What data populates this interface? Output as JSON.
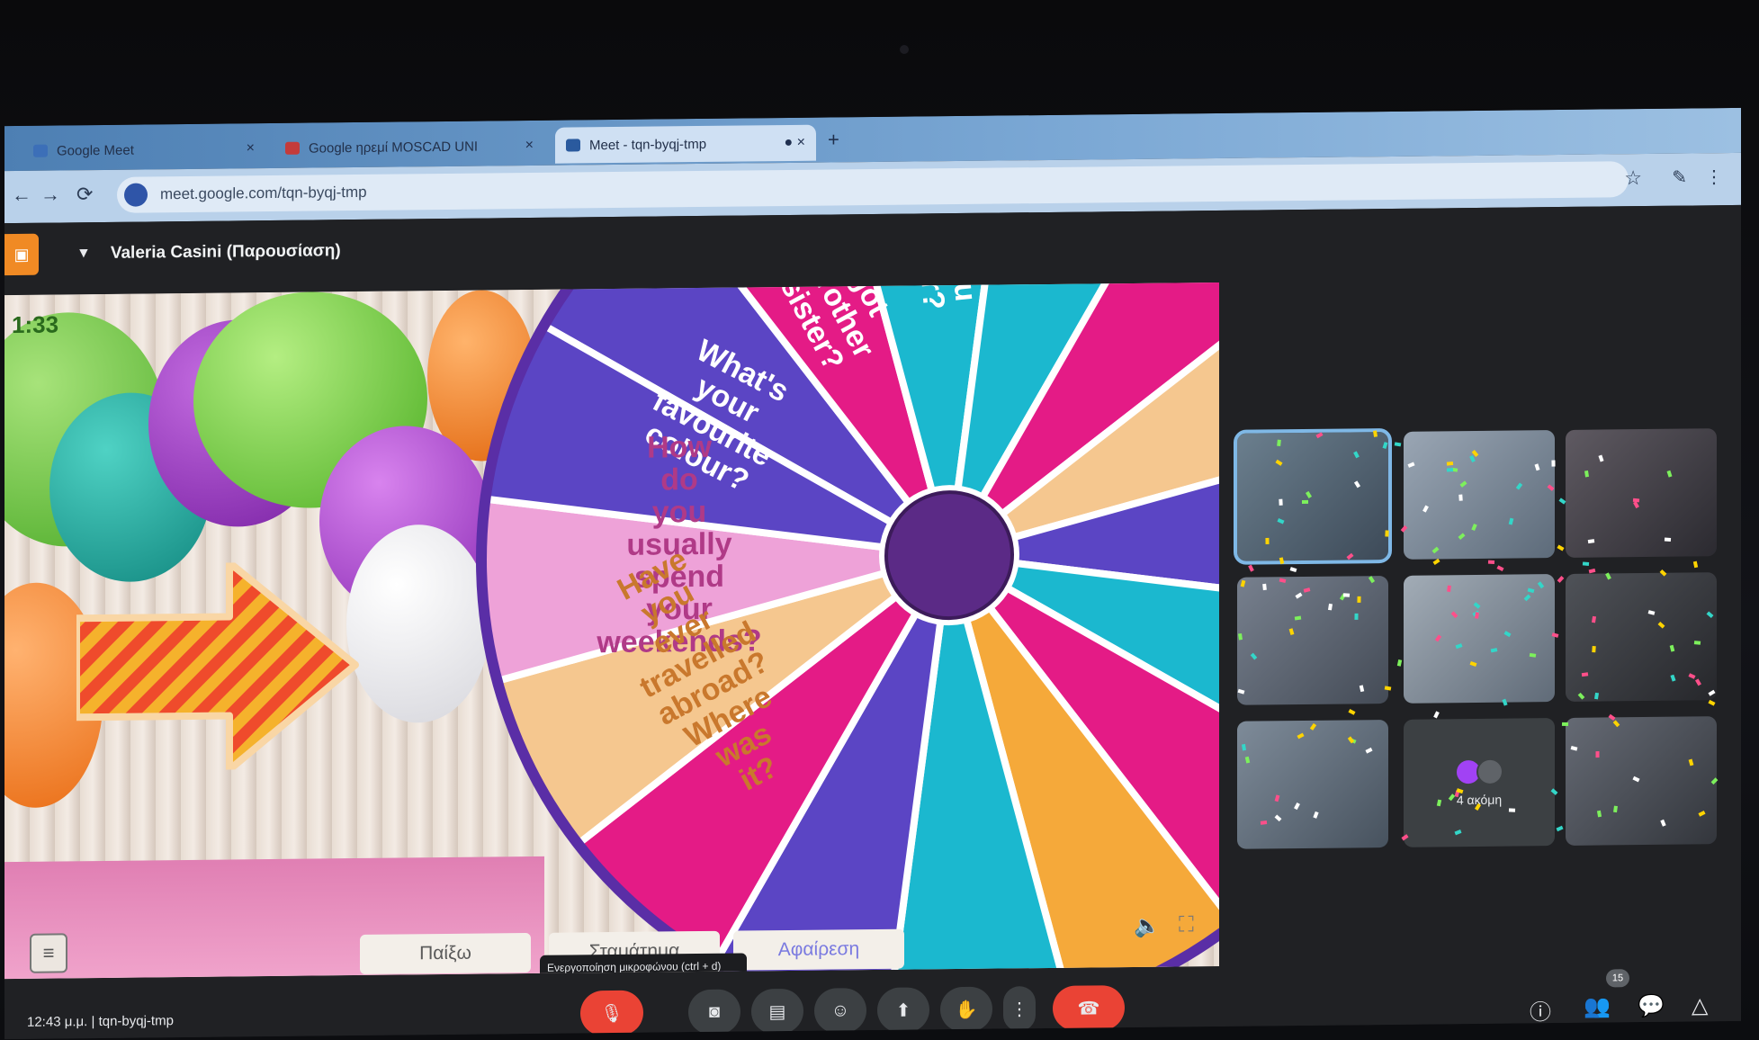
{
  "browser": {
    "tabs": [
      {
        "title": "Google Meet",
        "color": "#3c6fb8"
      },
      {
        "title": "Google ηρεμί MOSCAD UNI",
        "color": "#c43b3b"
      },
      {
        "title": "Meet - tqn-byqj-tmp",
        "color": "#2a5a9e"
      }
    ],
    "url": "meet.google.com/tqn-byqj-tmp"
  },
  "meet": {
    "presenter_name": "Valeria Casini (Παρουσίαση)",
    "clock": "12:43 μ.μ.",
    "meeting_code": "tqn-byqj-tmp",
    "participant_count": "15",
    "others_label": "4 ακόμη",
    "tooltip": "Ενεργοποίηση μικροφώνου (ctrl + d)"
  },
  "game": {
    "timer": "1:33",
    "play_button": "Παίξω",
    "spin_button": "Σταμάτημα",
    "remove_button": "Αφαίρεση",
    "wheel_segments": [
      {
        "text": "What's your favourite colour?",
        "color": "#5b45c4"
      },
      {
        "text": "How do you usually spend your weekends?",
        "color": "#eea2d8"
      },
      {
        "text": "Have you ever travelled abroad? Where was it?",
        "color": "#f5c78f"
      },
      {
        "text": "got brother sister?",
        "color": "#e41b86"
      },
      {
        "text": "ou er?",
        "color": "#1bb8cf"
      }
    ]
  }
}
